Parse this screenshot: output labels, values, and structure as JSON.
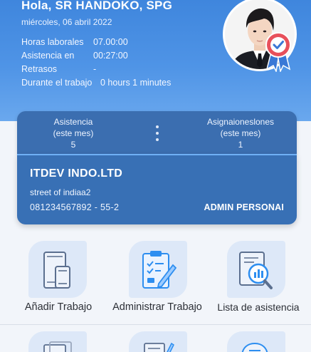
{
  "header": {
    "greeting": "Hola, SR HANDOKO, SPG",
    "date": "miércoles, 06 abril 2022",
    "rows": [
      {
        "label": "Horas laborales",
        "value": "07.00:00"
      },
      {
        "label": "Asistencia en",
        "value": "00:27:00"
      },
      {
        "label": "Retrasos",
        "value": "-"
      },
      {
        "label": "Durante el trabajo",
        "value": "0 hours  1 minutes"
      }
    ]
  },
  "profile": {
    "avatar_icon": "user-avatar",
    "badge_icon": "verified-badge-icon",
    "badge_color": "#e8505b"
  },
  "stats": {
    "left": {
      "line1": "Asistencia",
      "line2": "(este mes)",
      "value": "5"
    },
    "right": {
      "line1": "Asignaioneslones",
      "line2": "(este mes)",
      "value": "1"
    },
    "menu_icon": "more-vertical-icon"
  },
  "company": {
    "name": "ITDEV INDO.LTD",
    "street": "street of indiaa2",
    "phone": "081234567892 - 55-2",
    "role": "ADMIN PERSONAI"
  },
  "menu": [
    {
      "label": "Añadir Trabajo",
      "icon": "add-work-icon"
    },
    {
      "label": "Administrar Trabajo",
      "icon": "manage-work-icon"
    },
    {
      "label": "Lista de asistencia",
      "icon": "attendance-list-icon"
    }
  ],
  "colors": {
    "header": "#4a8fe3",
    "card": "#3870b5",
    "tile": "#dde8f8",
    "icon_stroke": "#5b6f8f",
    "icon_accent": "#2d8ef0"
  }
}
